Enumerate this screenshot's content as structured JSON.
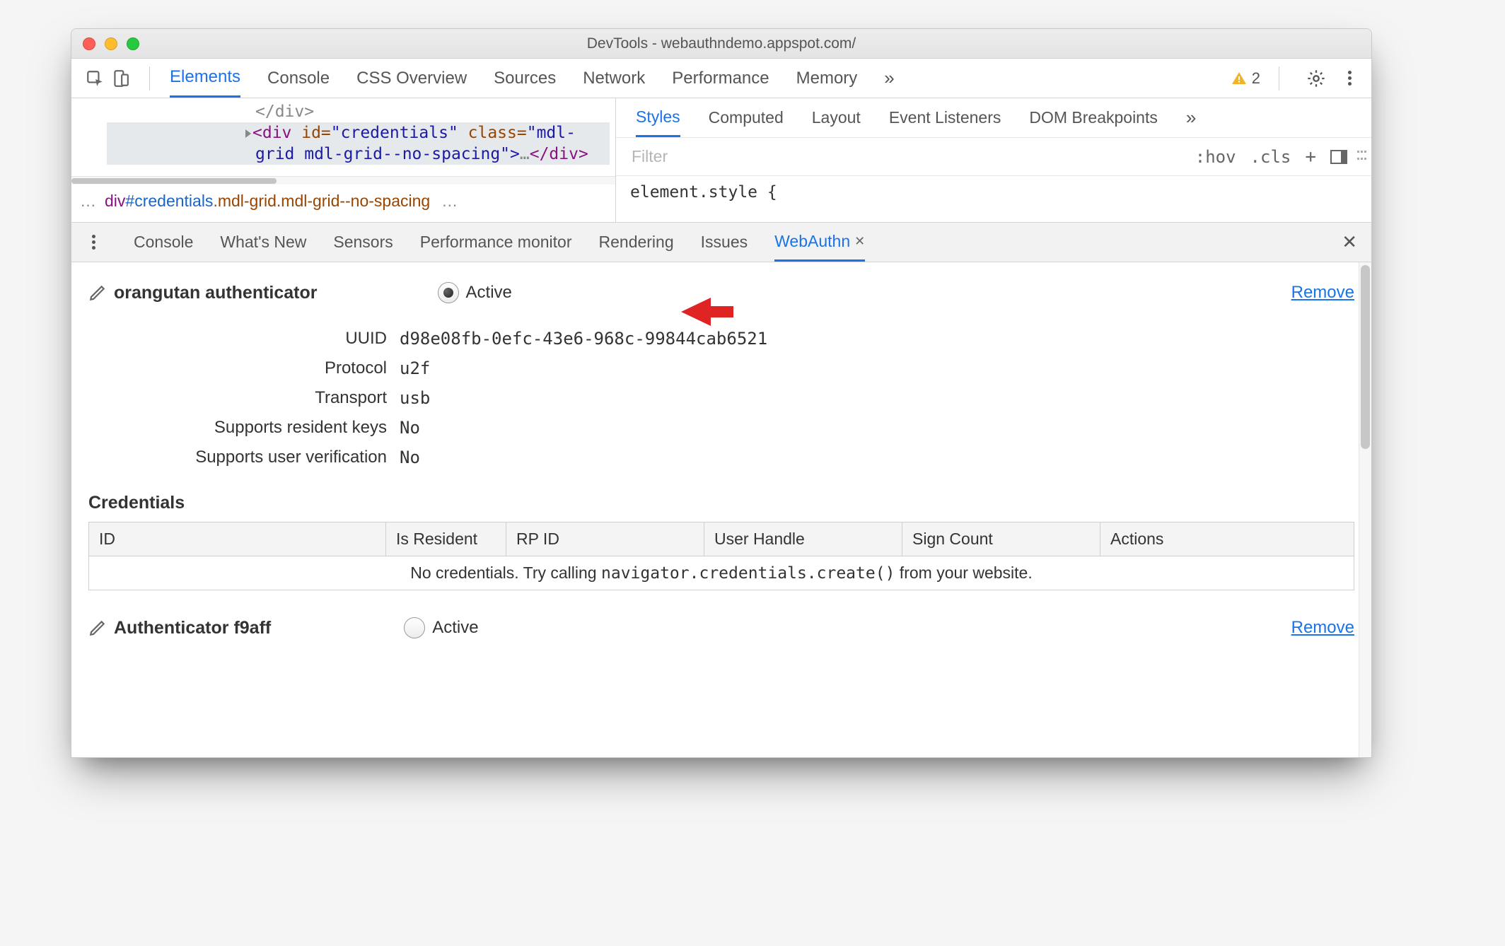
{
  "window": {
    "title": "DevTools - webauthndemo.appspot.com/"
  },
  "mainTabs": {
    "items": [
      "Elements",
      "Console",
      "CSS Overview",
      "Sources",
      "Network",
      "Performance",
      "Memory"
    ],
    "activeIndex": 0,
    "moreIndicator": "»"
  },
  "toolbarRight": {
    "warningCount": "2"
  },
  "elementsPane": {
    "line0": "</div>",
    "hl_pre": "<div",
    "hl_idAttr": " id=",
    "hl_idVal": "\"credentials\"",
    "hl_clsAttr": " class=",
    "hl_clsVal": "\"mdl-",
    "hl_line2": "grid mdl-grid--no-spacing\">",
    "hl_mid": "…",
    "hl_end": "</div>",
    "breadcrumbsPrefix": "…",
    "breadcrumbs_tag": "div",
    "breadcrumbs_id": "#credentials",
    "breadcrumbs_cls": ".mdl-grid.mdl-grid--no-spacing",
    "breadcrumbsSuffix": "…"
  },
  "stylesTabs": {
    "items": [
      "Styles",
      "Computed",
      "Layout",
      "Event Listeners",
      "DOM Breakpoints"
    ],
    "activeIndex": 0,
    "moreIndicator": "»"
  },
  "stylesFilter": {
    "placeholder": "Filter",
    "hov": ":hov",
    "cls": ".cls"
  },
  "stylesBody": {
    "elementStyle": "element.style {"
  },
  "drawerTabs": {
    "items": [
      "Console",
      "What's New",
      "Sensors",
      "Performance monitor",
      "Rendering",
      "Issues",
      "WebAuthn"
    ],
    "activeIndex": 6
  },
  "authenticator1": {
    "name": "orangutan authenticator",
    "activeLabel": "Active",
    "removeLabel": "Remove",
    "details": {
      "uuidLabel": "UUID",
      "uuid": "d98e08fb-0efc-43e6-968c-99844cab6521",
      "protocolLabel": "Protocol",
      "protocol": "u2f",
      "transportLabel": "Transport",
      "transport": "usb",
      "residentLabel": "Supports resident keys",
      "resident": "No",
      "verificationLabel": "Supports user verification",
      "verification": "No"
    }
  },
  "credentials": {
    "heading": "Credentials",
    "columns": [
      "ID",
      "Is Resident",
      "RP ID",
      "User Handle",
      "Sign Count",
      "Actions"
    ],
    "emptyPre": "No credentials. Try calling ",
    "emptyCode": "navigator.credentials.create()",
    "emptyPost": " from your website."
  },
  "authenticator2": {
    "name": "Authenticator f9aff",
    "activeLabel": "Active",
    "removeLabel": "Remove"
  }
}
